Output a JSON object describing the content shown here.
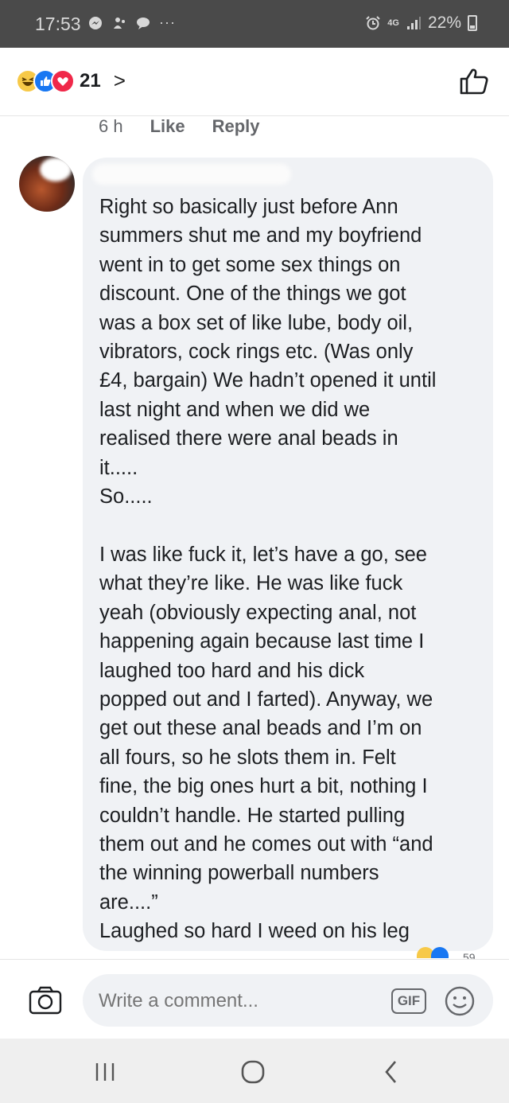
{
  "status_bar": {
    "time": "17:53",
    "dots": "···",
    "network": "4G",
    "battery": "22%"
  },
  "header": {
    "reactions": [
      "haha",
      "like",
      "love"
    ],
    "reaction_count": "21",
    "chevron": ">"
  },
  "meta": {
    "age": "6 h",
    "like_label": "Like",
    "reply_label": "Reply"
  },
  "comment": {
    "text": "Right so basically just before Ann\nsummers shut me and my boyfriend\nwent in to get some sex things on\ndiscount. One of the things we got\nwas a box set of like lube, body oil,\nvibrators, cock rings etc. (Was only\n£4, bargain) We hadn’t opened it until\nlast night and when we did we\nrealised there were anal beads in\nit.....\nSo.....\n\nI was like fuck it, let’s have a go, see\nwhat they’re like. He was like fuck\nyeah (obviously expecting anal, not\nhappening again because last time I\nlaughed too hard and his dick\npopped out and I farted). Anyway, we\nget out these anal beads and I’m on\nall fours, so he slots them in. Felt\nfine, the big ones hurt a bit, nothing I\ncouldn’t handle. He started pulling\nthem out and he comes out with “and\nthe winning powerball numbers\nare....”\nLaughed so hard I weed on his leg",
    "reaction_count_partial": "59"
  },
  "composer": {
    "placeholder": "Write a comment...",
    "gif_label": "GIF"
  },
  "colors": {
    "status_bar": "#4a4a4a",
    "bubble": "#f0f2f5",
    "text": "#1c1e21",
    "secondary_text": "#65676b",
    "like_blue": "#1877f2",
    "love_red": "#f02849",
    "haha_yellow": "#f7c948"
  },
  "icons": {
    "camera": "camera-icon",
    "emoji": "smiley-icon",
    "like": "thumbs-up-icon",
    "nav_recent": "recent-apps-icon",
    "nav_home": "home-icon",
    "nav_back": "back-icon"
  }
}
